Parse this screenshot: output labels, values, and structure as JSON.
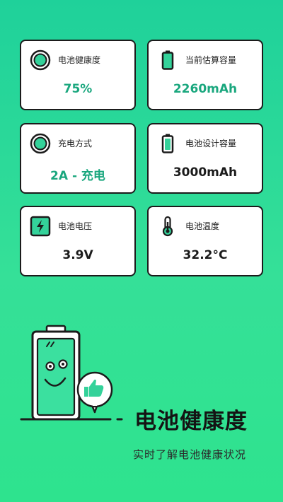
{
  "cards": [
    {
      "label": "电池健康度",
      "value": "75%",
      "icon": "health-ring-icon"
    },
    {
      "label": "当前估算容量",
      "value": "2260mAh",
      "icon": "battery-icon"
    },
    {
      "label": "充电方式",
      "value": "2A - 充电",
      "icon": "charge-ring-icon"
    },
    {
      "label": "电池设计容量",
      "value": "3000mAh",
      "icon": "battery-outline-icon"
    },
    {
      "label": "电池电压",
      "value": "3.9V",
      "icon": "lightning-icon"
    },
    {
      "label": "电池温度",
      "value": "32.2°C",
      "icon": "thermometer-icon"
    }
  ],
  "hero": {
    "title": "电池健康度",
    "subtitle": "实时了解电池健康状况"
  },
  "colors": {
    "background_top": "#1fd19a",
    "background_bottom": "#2ee38e",
    "accent_value": "#1aa77e",
    "icon_green": "#34d29a",
    "outline": "#1b1b1b"
  }
}
